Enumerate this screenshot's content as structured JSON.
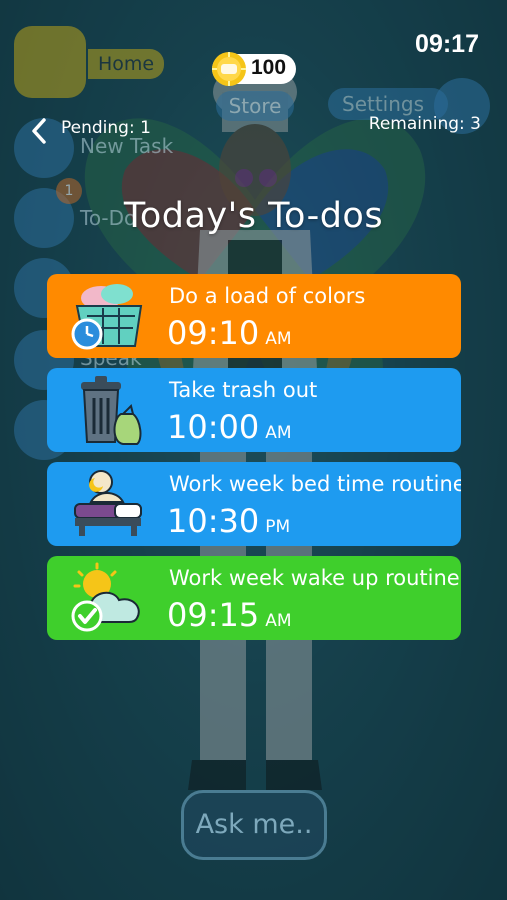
{
  "status_bar": {
    "time": "09:17"
  },
  "coins": {
    "value": "100"
  },
  "background_menu": {
    "home_label": "Home",
    "store_label": "Store",
    "settings_label": "Settings",
    "new_task_label": "New Task",
    "todos_label": "To-Do",
    "todos_badge": "1",
    "speak_label": "Speak"
  },
  "header": {
    "pending": "Pending: 1",
    "remaining": "Remaining: 3",
    "title": "Today's To-dos"
  },
  "todos": [
    {
      "title": "Do a load of colors",
      "time": "09:10",
      "ampm": "AM",
      "color": "#ff8a00",
      "icon": "laundry-basket-icon"
    },
    {
      "title": "Take trash out",
      "time": "10:00",
      "ampm": "AM",
      "color": "#1e9bf0",
      "icon": "trash-can-icon"
    },
    {
      "title": "Work week bed time routine",
      "time": "10:30",
      "ampm": "PM",
      "color": "#1e9bf0",
      "icon": "bed-icon"
    },
    {
      "title": "Work week wake up routine",
      "time": "09:15",
      "ampm": "AM",
      "color": "#3fcf2c",
      "icon": "sun-cloud-icon"
    }
  ],
  "ask_button": {
    "label": "Ask me.."
  }
}
